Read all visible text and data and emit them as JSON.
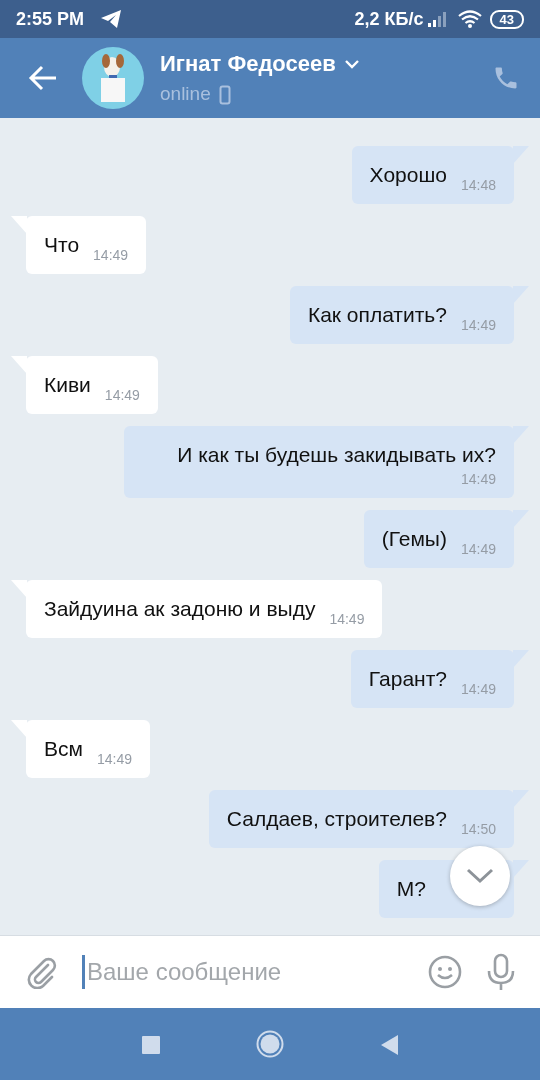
{
  "status_bar": {
    "time": "2:55 PM",
    "speed": "2,2 КБ/с",
    "battery": "43"
  },
  "header": {
    "name": "Игнат Федосеев",
    "status": "online"
  },
  "messages": [
    {
      "kind": "outgoing",
      "text": "Хорошо",
      "time": "14:48"
    },
    {
      "kind": "incoming",
      "text": "Что",
      "time": "14:49"
    },
    {
      "kind": "outgoing",
      "text": "Как оплатить?",
      "time": "14:49"
    },
    {
      "kind": "incoming",
      "text": "Киви",
      "time": "14:49"
    },
    {
      "kind": "outgoing",
      "text": "И как ты будешь закидывать их?",
      "time": "14:49"
    },
    {
      "kind": "outgoing",
      "text": "(Гемы)",
      "time": "14:49"
    },
    {
      "kind": "incoming",
      "text": "Зайдуина ак задоню и выду",
      "time": "14:49"
    },
    {
      "kind": "outgoing",
      "text": "Гарант?",
      "time": "14:49"
    },
    {
      "kind": "incoming",
      "text": "Всм",
      "time": "14:49"
    },
    {
      "kind": "outgoing",
      "text": "Салдаев, строителев?",
      "time": "14:50"
    },
    {
      "kind": "outgoing",
      "text": "М?"
    }
  ],
  "composer": {
    "placeholder": "Ваше сообщение"
  }
}
